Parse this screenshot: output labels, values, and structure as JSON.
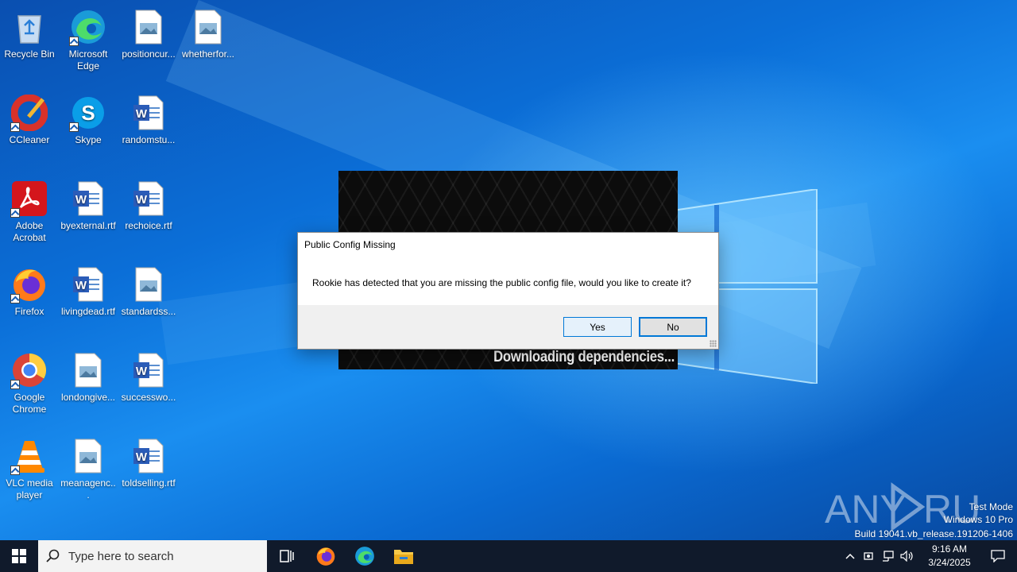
{
  "desktop": {
    "icons": [
      {
        "label": "Recycle Bin",
        "icon": "recycle-bin-icon"
      },
      {
        "label": "Microsoft Edge",
        "icon": "edge-icon"
      },
      {
        "label": "positioncur...",
        "icon": "image-file-icon"
      },
      {
        "label": "whetherfor...",
        "icon": "image-file-icon"
      },
      {
        "label": "CCleaner",
        "icon": "ccleaner-icon"
      },
      {
        "label": "Skype",
        "icon": "skype-icon"
      },
      {
        "label": "randomstu...",
        "icon": "word-doc-icon"
      },
      {
        "label": "Adobe Acrobat",
        "icon": "acrobat-icon"
      },
      {
        "label": "byexternal.rtf",
        "icon": "word-doc-icon"
      },
      {
        "label": "rechoice.rtf",
        "icon": "word-doc-icon"
      },
      {
        "label": "Firefox",
        "icon": "firefox-icon"
      },
      {
        "label": "livingdead.rtf",
        "icon": "word-doc-icon"
      },
      {
        "label": "standardss...",
        "icon": "image-file-icon"
      },
      {
        "label": "Google Chrome",
        "icon": "chrome-icon"
      },
      {
        "label": "londongive...",
        "icon": "image-file-icon"
      },
      {
        "label": "successwo...",
        "icon": "word-doc-icon"
      },
      {
        "label": "VLC media player",
        "icon": "vlc-icon"
      },
      {
        "label": "meanagenc...",
        "icon": "image-file-icon"
      },
      {
        "label": "toldselling.rtf",
        "icon": "word-doc-icon"
      }
    ]
  },
  "splash": {
    "status": "Downloading dependencies..."
  },
  "dialog": {
    "title": "Public Config Missing",
    "message": "Rookie has detected that you are missing the public config file, would you like to create it?",
    "yes_label": "Yes",
    "no_label": "No"
  },
  "watermark": {
    "brand": "ANY RUN",
    "line1": "Test Mode",
    "line2": "Windows 10 Pro",
    "line3": "Build 19041.vb_release.191206-1406"
  },
  "taskbar": {
    "search_placeholder": "Type here to search",
    "time": "9:16 AM",
    "date": "3/24/2025"
  },
  "colors": {
    "accent": "#0078d7",
    "taskbar": "#101a2b",
    "desktop": "#0b6fd8"
  }
}
